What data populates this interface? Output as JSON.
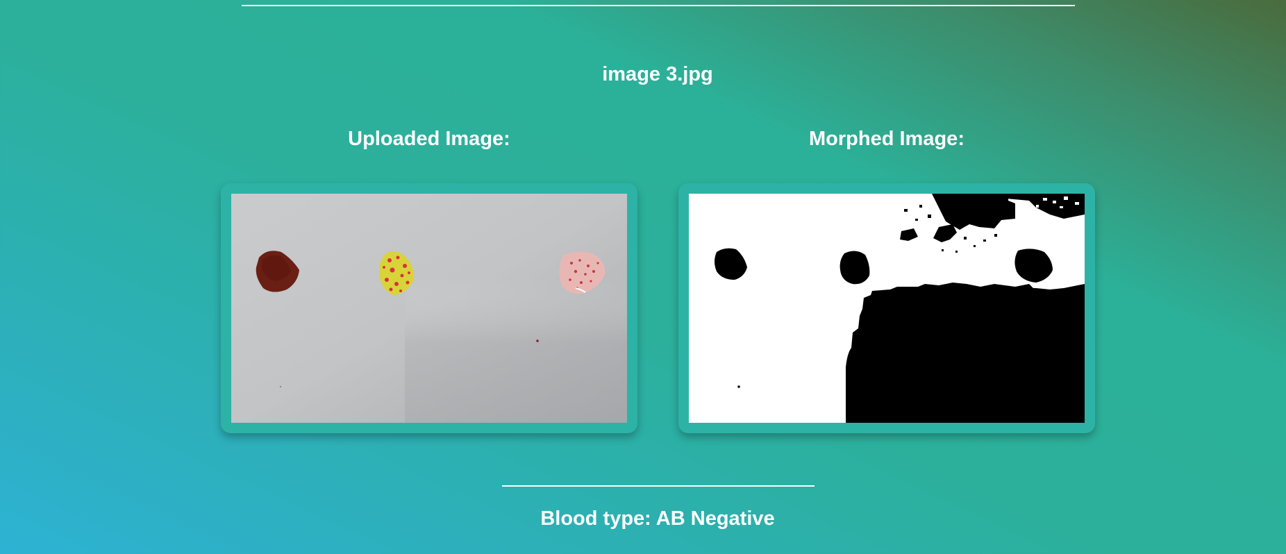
{
  "file": {
    "name": "image 3.jpg"
  },
  "panels": {
    "uploaded_title": "Uploaded Image:",
    "morphed_title": "Morphed Image:"
  },
  "result": {
    "text": "Blood type: AB Negative"
  },
  "colors": {
    "card_bg": "#2db3a6",
    "text": "#ffffff",
    "gradient_teal": "#2bb199",
    "gradient_olive": "#4a6b3c",
    "gradient_blue": "#2db2d4"
  }
}
